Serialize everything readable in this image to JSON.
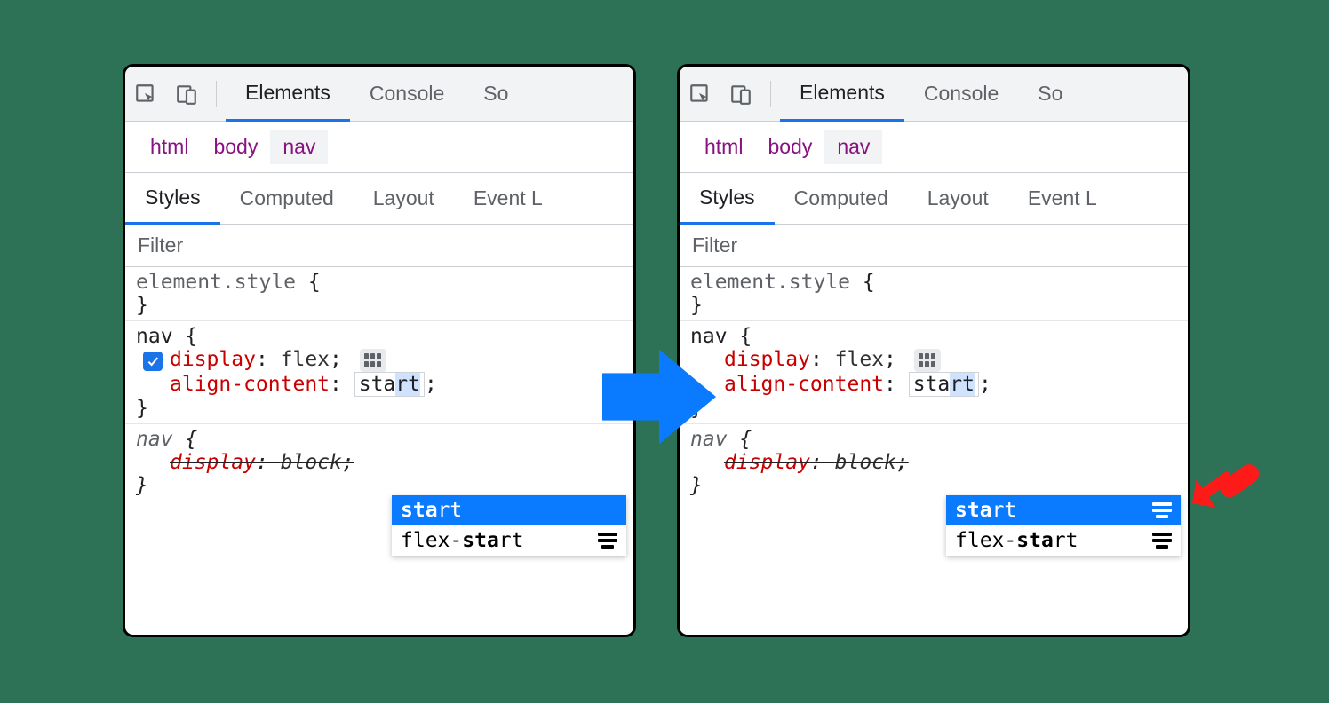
{
  "toolbar": {
    "tabs": {
      "elements": "Elements",
      "console": "Console",
      "sources_truncated": "So"
    }
  },
  "crumbs": {
    "html": "html",
    "body": "body",
    "nav": "nav"
  },
  "subtabs": {
    "styles": "Styles",
    "computed": "Computed",
    "layout": "Layout",
    "event_truncated": "Event L"
  },
  "filter": {
    "placeholder": "Filter"
  },
  "rules": {
    "element_style": "element.style",
    "nav_selector": "nav",
    "display_prop": "display",
    "display_val": "flex",
    "align_prop": "align-content",
    "align_typed": "sta",
    "align_suffix": "rt",
    "stale_display_prop": "display",
    "stale_display_val": "block"
  },
  "dropdown_left": {
    "opt1_bold": "sta",
    "opt1_rest": "rt",
    "opt2_pre": "flex-",
    "opt2_bold": "sta",
    "opt2_rest": "rt"
  },
  "dropdown_right": {
    "opt1_bold": "sta",
    "opt1_rest": "rt",
    "opt2_pre": "flex-",
    "opt2_bold": "sta",
    "opt2_rest": "rt"
  }
}
